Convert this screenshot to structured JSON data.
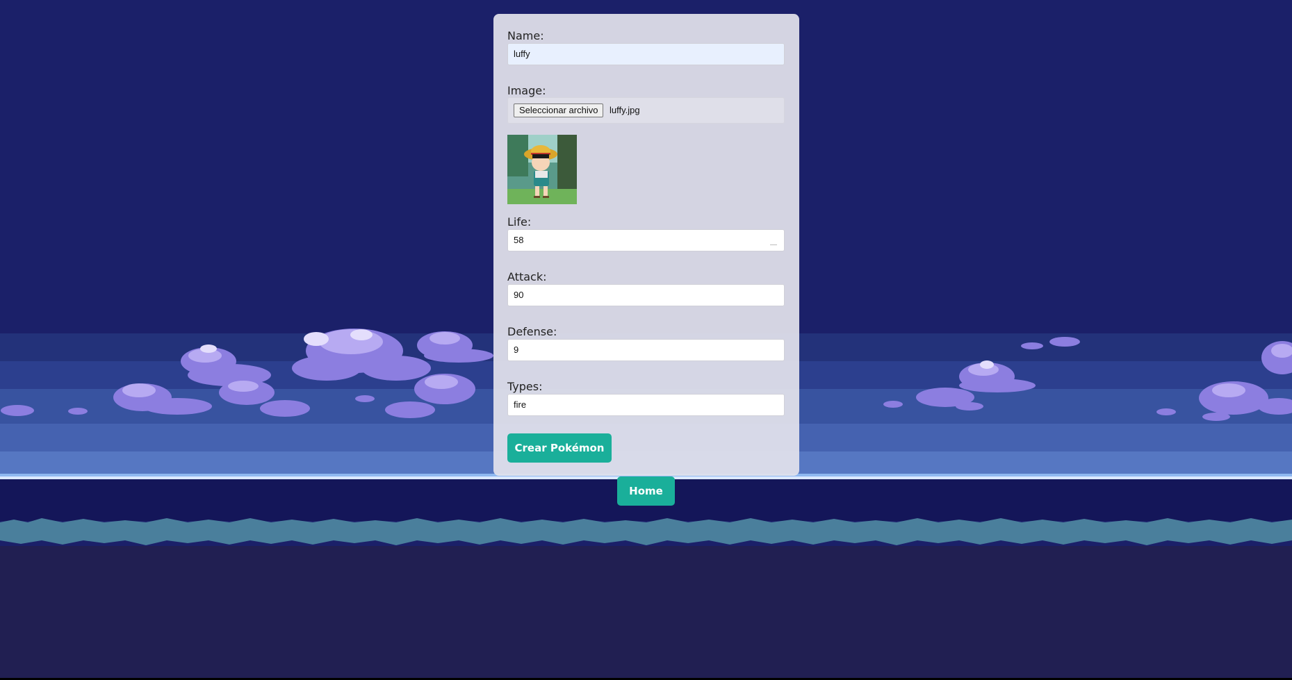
{
  "form": {
    "name": {
      "label": "Name:",
      "value": "luffy"
    },
    "image": {
      "label": "Image:",
      "button_label": "Seleccionar archivo",
      "file_name": "luffy.jpg",
      "preview_alt": "luffy"
    },
    "life": {
      "label": "Life:",
      "value": "58"
    },
    "attack": {
      "label": "Attack:",
      "value": "90"
    },
    "defense": {
      "label": "Defense:",
      "value": "9"
    },
    "types": {
      "label": "Types:",
      "value": "fire"
    },
    "submit_label": "Crear Pokémon"
  },
  "home_label": "Home",
  "colors": {
    "sky": "#1b2069",
    "card": "#e2e2ec",
    "accent": "#1aaf9a",
    "ground": "#211f52",
    "grass": "#4a7f9c"
  }
}
